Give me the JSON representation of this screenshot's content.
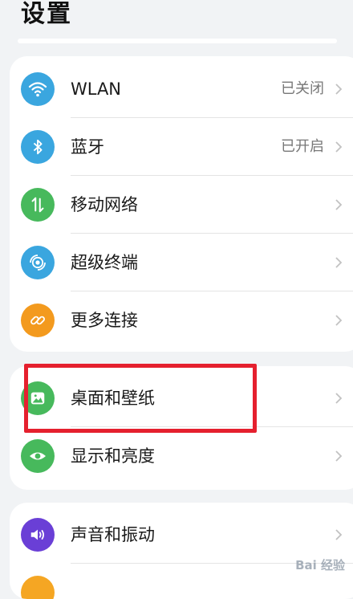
{
  "header": {
    "title": "设置"
  },
  "groups": [
    {
      "items": [
        {
          "label": "WLAN",
          "value": "已关闭",
          "icon": "wifi-icon",
          "color": "#3aa6df"
        },
        {
          "label": "蓝牙",
          "value": "已开启",
          "icon": "bluetooth-icon",
          "color": "#3aa6df"
        },
        {
          "label": "移动网络",
          "value": "",
          "icon": "mobile-data-icon",
          "color": "#47b95c"
        },
        {
          "label": "超级终端",
          "value": "",
          "icon": "super-device-icon",
          "color": "#3aa6df"
        },
        {
          "label": "更多连接",
          "value": "",
          "icon": "link-icon",
          "color": "#f39a1e"
        }
      ]
    },
    {
      "items": [
        {
          "label": "桌面和壁纸",
          "value": "",
          "icon": "wallpaper-icon",
          "color": "#47b95c"
        },
        {
          "label": "显示和亮度",
          "value": "",
          "icon": "display-eye-icon",
          "color": "#47b95c"
        }
      ]
    },
    {
      "items": [
        {
          "label": "声音和振动",
          "value": "",
          "icon": "sound-icon",
          "color": "#6a3fd6"
        },
        {
          "label": "",
          "value": "",
          "icon": "partial-icon",
          "color": "#f5a623"
        }
      ]
    }
  ],
  "watermark": "Bai 经验"
}
